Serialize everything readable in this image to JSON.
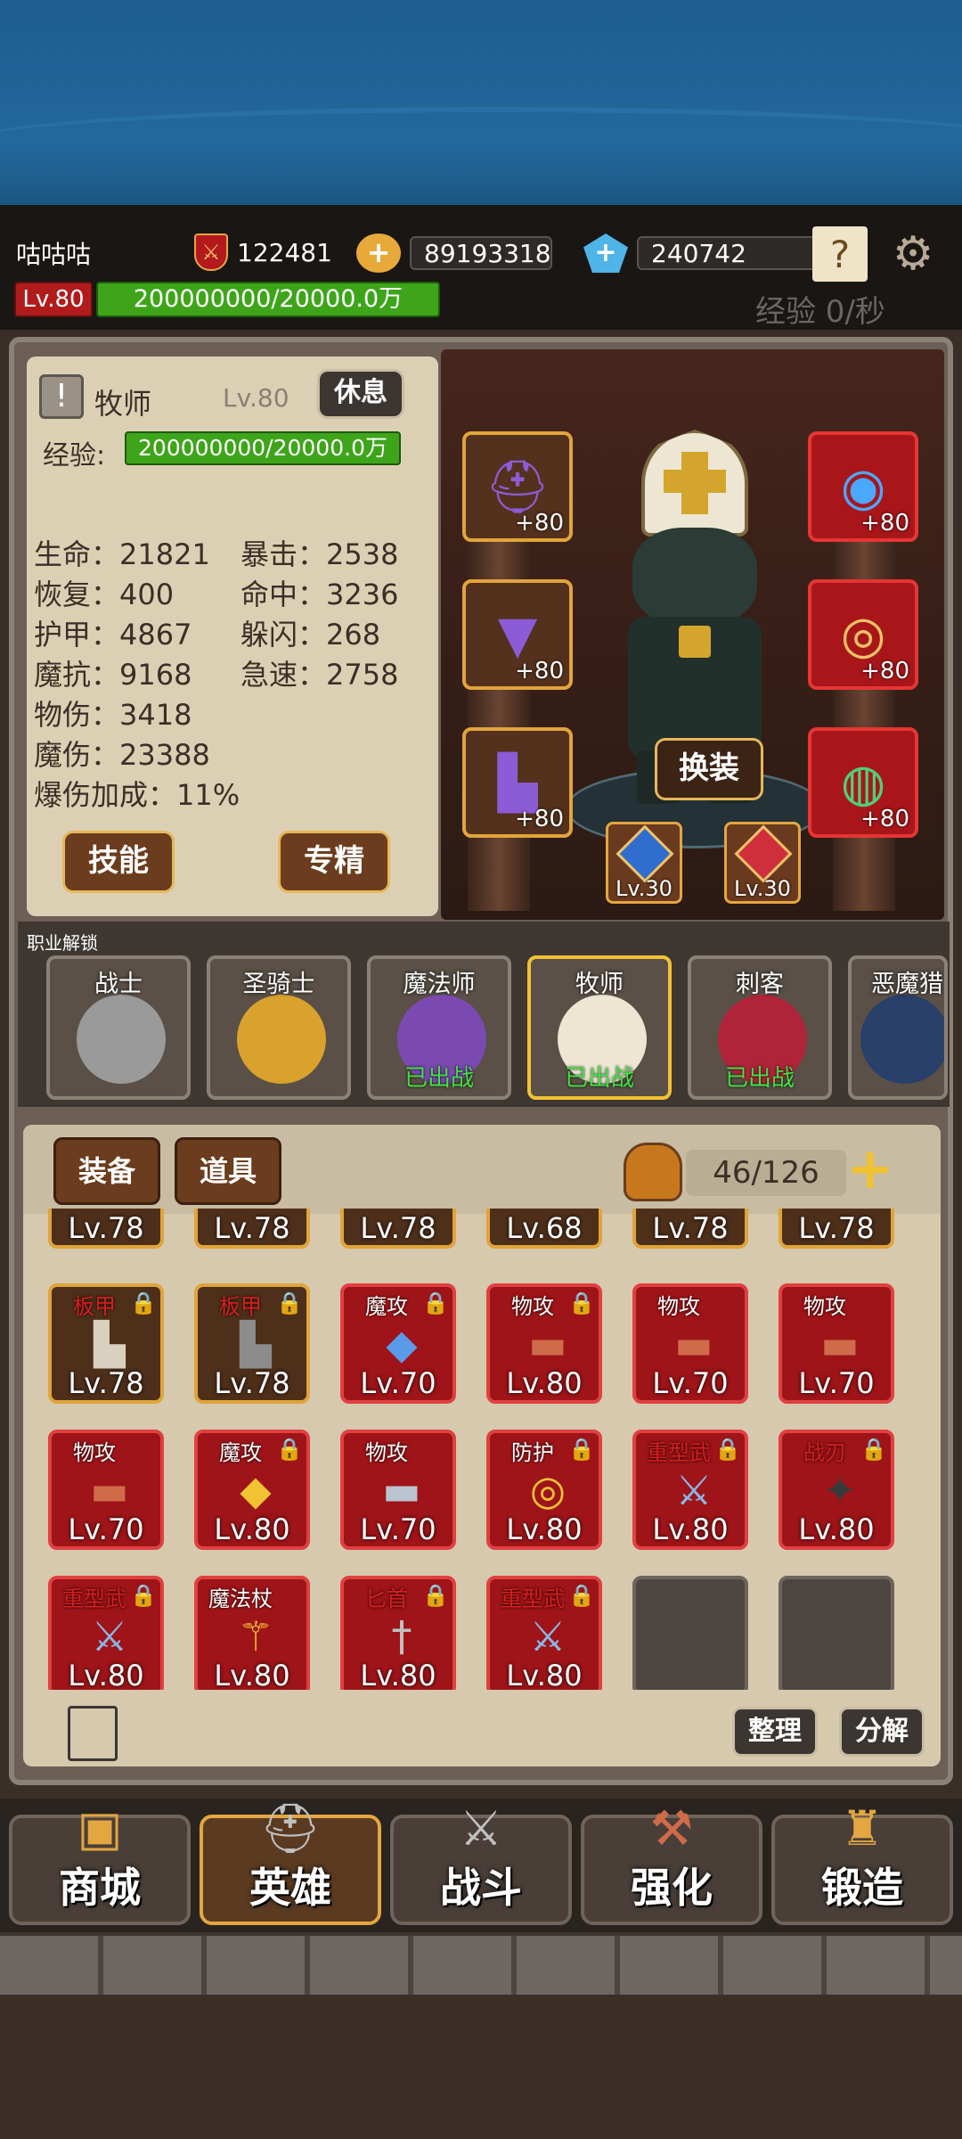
{
  "topbar": {
    "player_name": "咕咕咕",
    "power": "122481",
    "gold": "89193318",
    "gems": "240742",
    "level": "Lv.80",
    "exp_text": "200000000/20000.0万",
    "exp_rate": "经验 0/秒"
  },
  "hero": {
    "class_name": "牧师",
    "level": "Lv.80",
    "rest_label": "休息",
    "exp_label": "经验:",
    "exp_text": "200000000/20000.0万",
    "stats_left": [
      "生命：21821",
      "恢复：400",
      "护甲：4867",
      "魔抗：9168",
      "物伤：3418",
      "魔伤：23388",
      "爆伤加成：11%"
    ],
    "stats_right": [
      "暴击：2538",
      "命中：3236",
      "躲闪：268",
      "急速：2758"
    ],
    "skill_label": "技能",
    "spec_label": "专精",
    "change_outfit_label": "换装",
    "equip_levels": [
      "+80",
      "+80",
      "+80",
      "+80",
      "+80",
      "+80"
    ],
    "medal_levels": [
      "Lv.30",
      "Lv.30"
    ]
  },
  "classes": {
    "header": "职业解锁",
    "items": [
      {
        "name": "战士",
        "status": ""
      },
      {
        "name": "圣骑士",
        "status": ""
      },
      {
        "name": "魔法师",
        "status": "已出战"
      },
      {
        "name": "牧师",
        "status": "已出战"
      },
      {
        "name": "刺客",
        "status": "已出战"
      },
      {
        "name": "恶魔猎",
        "status": ""
      }
    ]
  },
  "inventory": {
    "tab_equipment": "装备",
    "tab_items": "道具",
    "capacity": "46/126",
    "row0": [
      "Lv.78",
      "Lv.78",
      "Lv.78",
      "Lv.68",
      "Lv.78",
      "Lv.78"
    ],
    "rows": [
      [
        {
          "label": "板甲",
          "lv": "Lv.78"
        },
        {
          "label": "板甲",
          "lv": "Lv.78"
        },
        {
          "label": "魔攻",
          "lv": "Lv.70"
        },
        {
          "label": "物攻",
          "lv": "Lv.80"
        },
        {
          "label": "物攻",
          "lv": "Lv.70"
        },
        {
          "label": "物攻",
          "lv": "Lv.70"
        }
      ],
      [
        {
          "label": "物攻",
          "lv": "Lv.70"
        },
        {
          "label": "魔攻",
          "lv": "Lv.80"
        },
        {
          "label": "物攻",
          "lv": "Lv.70"
        },
        {
          "label": "防护",
          "lv": "Lv.80"
        },
        {
          "label": "重型武",
          "lv": "Lv.80"
        },
        {
          "label": "战刃",
          "lv": "Lv.80"
        }
      ],
      [
        {
          "label": "重型武",
          "lv": "Lv.80"
        },
        {
          "label": "魔法杖",
          "lv": "Lv.80"
        },
        {
          "label": "匕首",
          "lv": "Lv.80"
        },
        {
          "label": "重型武",
          "lv": "Lv.80"
        }
      ]
    ],
    "sort_label": "整理",
    "decompose_label": "分解"
  },
  "nav": [
    "商城",
    "英雄",
    "战斗",
    "强化",
    "锻造"
  ],
  "colors": {
    "accent_gold": "#e3a640",
    "exp_green": "#3ea51a",
    "level_red": "#b21b1b",
    "item_red": "#9e1418"
  }
}
